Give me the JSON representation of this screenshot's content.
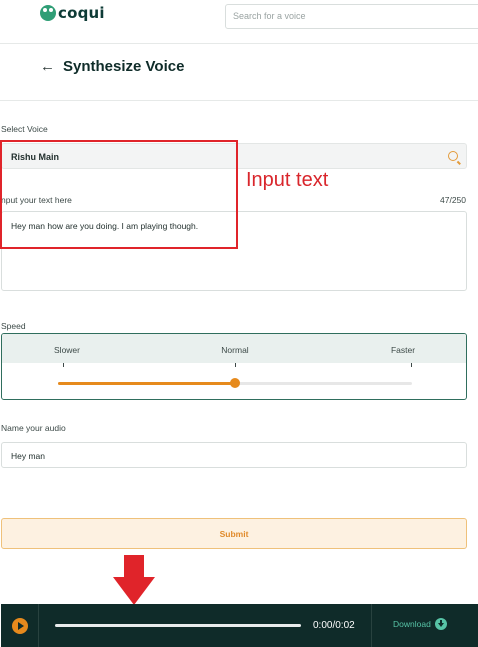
{
  "header": {
    "logo_text": "coqui",
    "search_placeholder": "Search for a voice"
  },
  "page": {
    "title": "Synthesize Voice"
  },
  "form": {
    "select_voice_label": "Select Voice",
    "selected_voice": "Rishu Main",
    "input_text_label": "nput your text here",
    "char_count": "47/250",
    "input_text_value": "Hey man how are you doing. I am playing though.",
    "speed_label": "Speed",
    "speed_ticks": [
      "Slower",
      "Normal",
      "Faster"
    ],
    "speed_level": 0.5,
    "name_label": "Name your audio",
    "name_value": "Hey man",
    "submit_label": "Submit"
  },
  "annotation": {
    "label": "Input text",
    "color": "#e0242a"
  },
  "player": {
    "time": "0:00/0:02",
    "download_label": "Download",
    "progress": 0.0
  },
  "colors": {
    "accent": "#e68a1d",
    "brand_dark": "#0f2b29",
    "brand_green": "#2f9e76"
  }
}
